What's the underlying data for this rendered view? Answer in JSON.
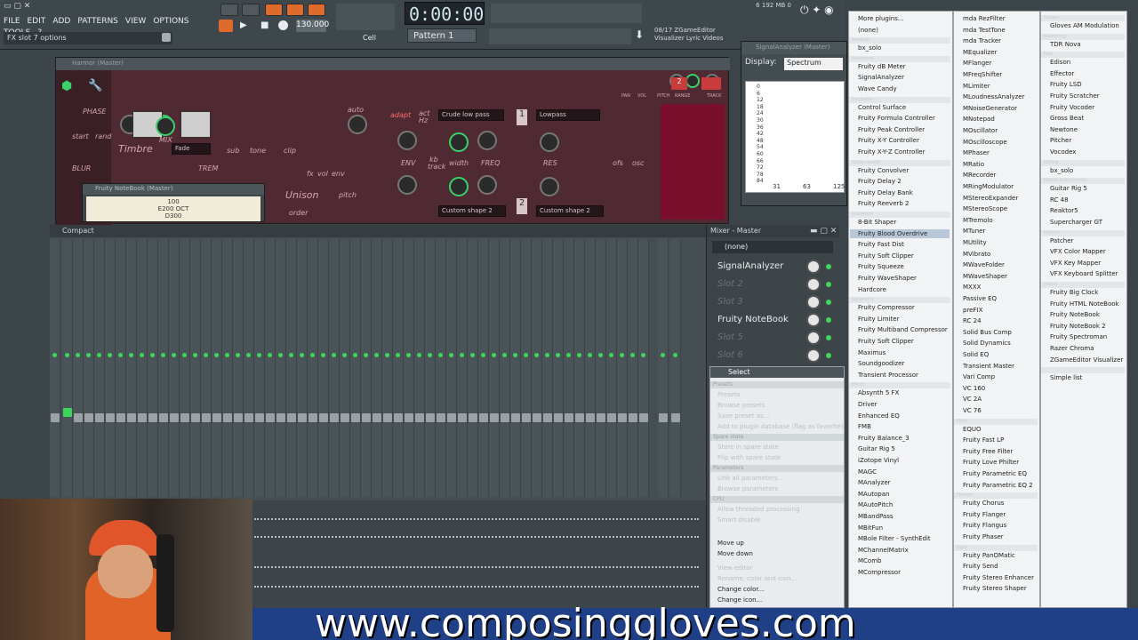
{
  "topbar": {
    "menus": [
      "FILE",
      "EDIT",
      "ADD",
      "PATTERNS",
      "VIEW",
      "OPTIONS",
      "TOOLS",
      "?"
    ],
    "hint": "FX slot 7 options",
    "time": "0:00:00",
    "tempo": "130.000",
    "pattern": "Pattern 1",
    "news": [
      "08/17  ZGameEditor",
      "Visualizer Lyric Videos"
    ],
    "cpu": [
      "6",
      "192 MB",
      "0"
    ],
    "snap": "Cell"
  },
  "harmor": {
    "title": "Harmor (Master)",
    "labels": [
      "PHASE",
      "start",
      "rand",
      "Timbre",
      "MIX",
      "Fade",
      "BLUR",
      "TREM",
      "sub",
      "tone",
      "clip",
      "fx",
      "vol",
      "env",
      "auto",
      "Unison",
      "pitch",
      "order",
      "adapt",
      "act",
      "Hz",
      "ENV",
      "kb",
      "track",
      "width",
      "FREQ",
      "RES",
      "ofs",
      "osc",
      "fx",
      "Hz",
      "PAN",
      "VOL",
      "PITCH",
      "RANGE",
      "TRACK"
    ],
    "filter1": "Crude low pass",
    "filter2": "Lowpass",
    "shape1": "Custom shape 2",
    "shape2": "Custom shape 2",
    "num1": "1",
    "num2": "2",
    "range": "2"
  },
  "notebook": {
    "title": "Fruity NoteBook (Master)",
    "lines": [
      "100",
      "E200 OCT",
      "D300"
    ]
  },
  "analyzer": {
    "title": "SignalAnalyzer (Master)",
    "display_label": "Display:",
    "display_value": "Spectrum",
    "y_ticks": [
      "0",
      "6",
      "12",
      "18",
      "24",
      "30",
      "36",
      "42",
      "48",
      "54",
      "60",
      "66",
      "72",
      "78",
      "84"
    ],
    "x_ticks": [
      "31",
      "63",
      "125"
    ]
  },
  "mixer": {
    "title": "Mixer - Master",
    "view": "Compact"
  },
  "fxpanel": {
    "title": "Mixer - Master",
    "input": "(none)",
    "slots": [
      {
        "label": "SignalAnalyzer",
        "empty": false
      },
      {
        "label": "Slot 2",
        "empty": true
      },
      {
        "label": "Slot 3",
        "empty": true
      },
      {
        "label": "Fruity NoteBook",
        "empty": false
      },
      {
        "label": "Slot 5",
        "empty": true
      },
      {
        "label": "Slot 6",
        "empty": true
      }
    ]
  },
  "context_menu": {
    "select": "Select",
    "items": [
      {
        "t": "Presets",
        "h": true
      },
      {
        "t": "Presets"
      },
      {
        "t": "Browse presets"
      },
      {
        "t": "Save preset as..."
      },
      {
        "t": "Add to plugin database (flag as favorite)"
      },
      {
        "t": "Spare state",
        "h": true
      },
      {
        "t": "Store in spare state"
      },
      {
        "t": "Flip with spare state"
      },
      {
        "t": "Parameters",
        "h": true
      },
      {
        "t": "Link all parameters..."
      },
      {
        "t": "Browse parameters"
      },
      {
        "t": "CPU",
        "h": true
      },
      {
        "t": "Allow threaded processing"
      },
      {
        "t": "Smart disable"
      },
      {
        "t": "Move up",
        "en": true
      },
      {
        "t": "Move down",
        "en": true
      },
      {
        "t": "View editor"
      },
      {
        "t": "Rename, color and icon..."
      },
      {
        "t": "Change color...",
        "en": true
      },
      {
        "t": "Change icon...",
        "en": true
      }
    ]
  },
  "plugin_menu": {
    "col1": [
      {
        "t": "More plugins...",
        "en": true
      },
      {
        "t": "(none)",
        "en": true
      },
      {
        "t": "Analysis",
        "h": true
      },
      {
        "t": "bx_solo",
        "en": true
      },
      {
        "t": "Analyzers",
        "h": true
      },
      {
        "t": "Fruity dB Meter"
      },
      {
        "t": "SignalAnalyzer"
      },
      {
        "t": "Wave Candy"
      },
      {
        "t": "Controller",
        "h": true
      },
      {
        "t": "Control Surface"
      },
      {
        "t": "Fruity Formula Controller"
      },
      {
        "t": "Fruity Peak Controller"
      },
      {
        "t": "Fruity X-Y Controller"
      },
      {
        "t": "Fruity X-Y-Z Controller"
      },
      {
        "t": "Delay reverb",
        "h": true
      },
      {
        "t": "Fruity Convolver"
      },
      {
        "t": "Fruity Delay 2"
      },
      {
        "t": "Fruity Delay Bank"
      },
      {
        "t": "Fruity Reeverb 2"
      },
      {
        "t": "Distortion",
        "h": true
      },
      {
        "t": "8-Bit Shaper"
      },
      {
        "t": "Fruity Blood Overdrive",
        "hl": true
      },
      {
        "t": "Fruity Fast Dist"
      },
      {
        "t": "Fruity Soft Clipper"
      },
      {
        "t": "Fruity Squeeze"
      },
      {
        "t": "Fruity WaveShaper"
      },
      {
        "t": "Hardcore"
      },
      {
        "t": "Dynamics",
        "h": true
      },
      {
        "t": "Fruity Compressor"
      },
      {
        "t": "Fruity Limiter"
      },
      {
        "t": "Fruity Multiband Compressor"
      },
      {
        "t": "Fruity Soft Clipper"
      },
      {
        "t": "Maximus"
      },
      {
        "t": "Soundgoodizer"
      },
      {
        "t": "Transient Processor"
      },
      {
        "t": "Effect",
        "h": true
      },
      {
        "t": "Absynth 5 FX"
      },
      {
        "t": "Driver"
      },
      {
        "t": "Enhanced EQ"
      },
      {
        "t": "FMB"
      },
      {
        "t": "Fruity Balance_3"
      },
      {
        "t": "Guitar Rig 5"
      },
      {
        "t": "iZotope Vinyl"
      },
      {
        "t": "MAGC"
      },
      {
        "t": "MAnalyzer"
      },
      {
        "t": "MAutopan"
      },
      {
        "t": "MAutoPitch"
      },
      {
        "t": "MBandPass"
      },
      {
        "t": "MBitFun"
      },
      {
        "t": "MBole Filter - SynthEdit"
      },
      {
        "t": "MChannelMatrix"
      },
      {
        "t": "MComb"
      },
      {
        "t": "MCompressor"
      }
    ],
    "col2": [
      {
        "t": "mda RezFilter"
      },
      {
        "t": "mda TestTone"
      },
      {
        "t": "mda Tracker"
      },
      {
        "t": "MEqualizer"
      },
      {
        "t": "MFlanger"
      },
      {
        "t": "MFreqShifter"
      },
      {
        "t": "MLimiter"
      },
      {
        "t": "MLoudnessAnalyzer"
      },
      {
        "t": "MNoiseGenerator"
      },
      {
        "t": "MNotepad"
      },
      {
        "t": "MOscillator"
      },
      {
        "t": "MOscilloscope"
      },
      {
        "t": "MPhaser"
      },
      {
        "t": "MRatio"
      },
      {
        "t": "MRecorder"
      },
      {
        "t": "MRingModulator"
      },
      {
        "t": "MStereoExpander"
      },
      {
        "t": "MStereoScope"
      },
      {
        "t": "MTremolo"
      },
      {
        "t": "MTuner"
      },
      {
        "t": "MUtility"
      },
      {
        "t": "MVibrato"
      },
      {
        "t": "MWaveFolder"
      },
      {
        "t": "MWaveShaper"
      },
      {
        "t": "MXXX"
      },
      {
        "t": "Passive EQ"
      },
      {
        "t": "preFIX"
      },
      {
        "t": "RC 24"
      },
      {
        "t": "Solid Bus Comp"
      },
      {
        "t": "Solid Dynamics"
      },
      {
        "t": "Solid EQ"
      },
      {
        "t": "Transient Master"
      },
      {
        "t": "Vari Comp"
      },
      {
        "t": "VC 160"
      },
      {
        "t": "VC 2A"
      },
      {
        "t": "VC 76"
      },
      {
        "t": "Filter",
        "h": true
      },
      {
        "t": "EQUO"
      },
      {
        "t": "Fruity Fast LP"
      },
      {
        "t": "Fruity Free Filter"
      },
      {
        "t": "Fruity Love Philter"
      },
      {
        "t": "Fruity Parametric EQ"
      },
      {
        "t": "Fruity Parametric EQ 2"
      },
      {
        "t": "Flanger",
        "h": true
      },
      {
        "t": "Fruity Chorus"
      },
      {
        "t": "Fruity Flanger"
      },
      {
        "t": "Fruity Flangus"
      },
      {
        "t": "Fruity Phaser"
      },
      {
        "t": "Gain",
        "h": true
      },
      {
        "t": "Fruity PanOMatic"
      },
      {
        "t": "Fruity Send"
      },
      {
        "t": "Fruity Stereo Enhancer"
      },
      {
        "t": "Fruity Stereo Shaper"
      }
    ],
    "col3": [
      {
        "t": "Gloves",
        "h": true
      },
      {
        "t": "Gloves AM Modulation"
      },
      {
        "t": "Mastering",
        "h": true
      },
      {
        "t": "TDR Nova"
      },
      {
        "t": "Misc",
        "h": true
      },
      {
        "t": "Edison"
      },
      {
        "t": "Effector"
      },
      {
        "t": "Fruity LSD"
      },
      {
        "t": "Fruity Scratcher"
      },
      {
        "t": "Fruity Vocoder"
      },
      {
        "t": "Gross Beat"
      },
      {
        "t": "Newtone"
      },
      {
        "t": "Pitcher"
      },
      {
        "t": "Vocodex"
      },
      {
        "t": "Mixing",
        "h": true
      },
      {
        "t": "bx_solo"
      },
      {
        "t": "Native Instruments",
        "h": true
      },
      {
        "t": "Guitar Rig 5"
      },
      {
        "t": "RC 48"
      },
      {
        "t": "Reaktor5"
      },
      {
        "t": "Supercharger GT"
      },
      {
        "t": "Patcher",
        "h": true
      },
      {
        "t": "Patcher"
      },
      {
        "t": "VFX Color Mapper"
      },
      {
        "t": "VFX Key Mapper"
      },
      {
        "t": "VFX Keyboard Splitter"
      },
      {
        "t": "Visual",
        "h": true
      },
      {
        "t": "Fruity Big Clock"
      },
      {
        "t": "Fruity HTML NoteBook"
      },
      {
        "t": "Fruity NoteBook"
      },
      {
        "t": "Fruity NoteBook 2"
      },
      {
        "t": "Fruity Spectroman"
      },
      {
        "t": "Razer Chroma"
      },
      {
        "t": "ZGameEditor Visualizer"
      },
      {
        "t": "",
        "h": true
      },
      {
        "t": "Simple list"
      }
    ]
  },
  "banner": {
    "url": "www.composinggloves.com"
  },
  "colors": {
    "accent": "#e06a2b",
    "led": "#3fd55a",
    "banner": "#1f3f86",
    "harmor": "#4f2a33"
  }
}
